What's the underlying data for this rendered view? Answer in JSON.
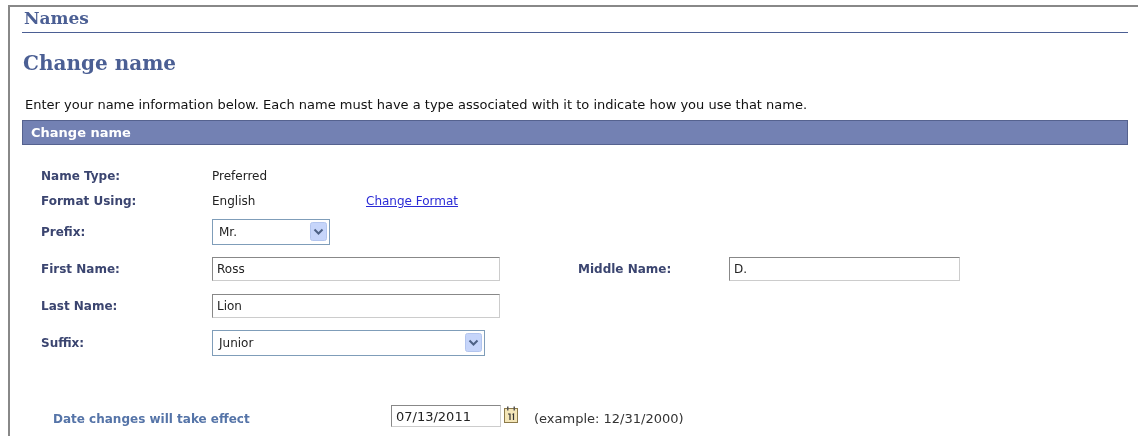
{
  "page_title": "Names",
  "heading": "Change name",
  "instructions": "Enter your name information below. Each name must have a type associated with it to indicate how you use that name.",
  "section": {
    "title": "Change name",
    "rows": [
      {
        "items": [
          {
            "kind": "display",
            "label": "Name Type:",
            "value": "Preferred"
          }
        ]
      },
      {
        "items": [
          {
            "kind": "display",
            "label": "Format Using:",
            "value": "English",
            "link": "Change Format"
          }
        ]
      },
      {
        "items": [
          {
            "kind": "select",
            "label": "Prefix:",
            "value": "Mr."
          }
        ]
      },
      {
        "items": [
          {
            "kind": "input",
            "label": "First Name:",
            "value": "Ross"
          },
          {
            "kind": "input",
            "label": "Middle Name:",
            "value": "D."
          }
        ]
      },
      {
        "items": [
          {
            "kind": "input",
            "label": "Last Name:",
            "value": "Lion"
          }
        ]
      },
      {
        "items": [
          {
            "kind": "select",
            "label": "Suffix:",
            "value": "Junior"
          }
        ]
      }
    ]
  },
  "effective_date": {
    "label": "Date changes will take effect",
    "value": "07/13/2011",
    "hint": "(example: 12/31/2000)"
  }
}
